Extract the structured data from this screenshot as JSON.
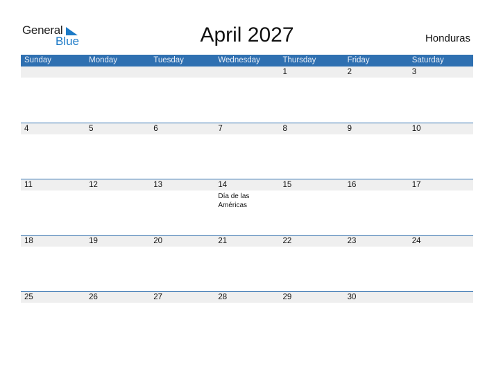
{
  "logo": {
    "general": "General",
    "blue": "Blue"
  },
  "title": "April 2027",
  "country": "Honduras",
  "colors": {
    "header_bg": "#2f70b1",
    "date_strip": "#efefef",
    "logo_blue": "#1c7ac7"
  },
  "weekdays": [
    "Sunday",
    "Monday",
    "Tuesday",
    "Wednesday",
    "Thursday",
    "Friday",
    "Saturday"
  ],
  "weeks": [
    [
      {
        "d": ""
      },
      {
        "d": ""
      },
      {
        "d": ""
      },
      {
        "d": ""
      },
      {
        "d": "1"
      },
      {
        "d": "2"
      },
      {
        "d": "3"
      }
    ],
    [
      {
        "d": "4"
      },
      {
        "d": "5"
      },
      {
        "d": "6"
      },
      {
        "d": "7"
      },
      {
        "d": "8"
      },
      {
        "d": "9"
      },
      {
        "d": "10"
      }
    ],
    [
      {
        "d": "11"
      },
      {
        "d": "12"
      },
      {
        "d": "13"
      },
      {
        "d": "14",
        "event": "Día de las Américas"
      },
      {
        "d": "15"
      },
      {
        "d": "16"
      },
      {
        "d": "17"
      }
    ],
    [
      {
        "d": "18"
      },
      {
        "d": "19"
      },
      {
        "d": "20"
      },
      {
        "d": "21"
      },
      {
        "d": "22"
      },
      {
        "d": "23"
      },
      {
        "d": "24"
      }
    ],
    [
      {
        "d": "25"
      },
      {
        "d": "26"
      },
      {
        "d": "27"
      },
      {
        "d": "28"
      },
      {
        "d": "29"
      },
      {
        "d": "30"
      },
      {
        "d": ""
      }
    ]
  ]
}
